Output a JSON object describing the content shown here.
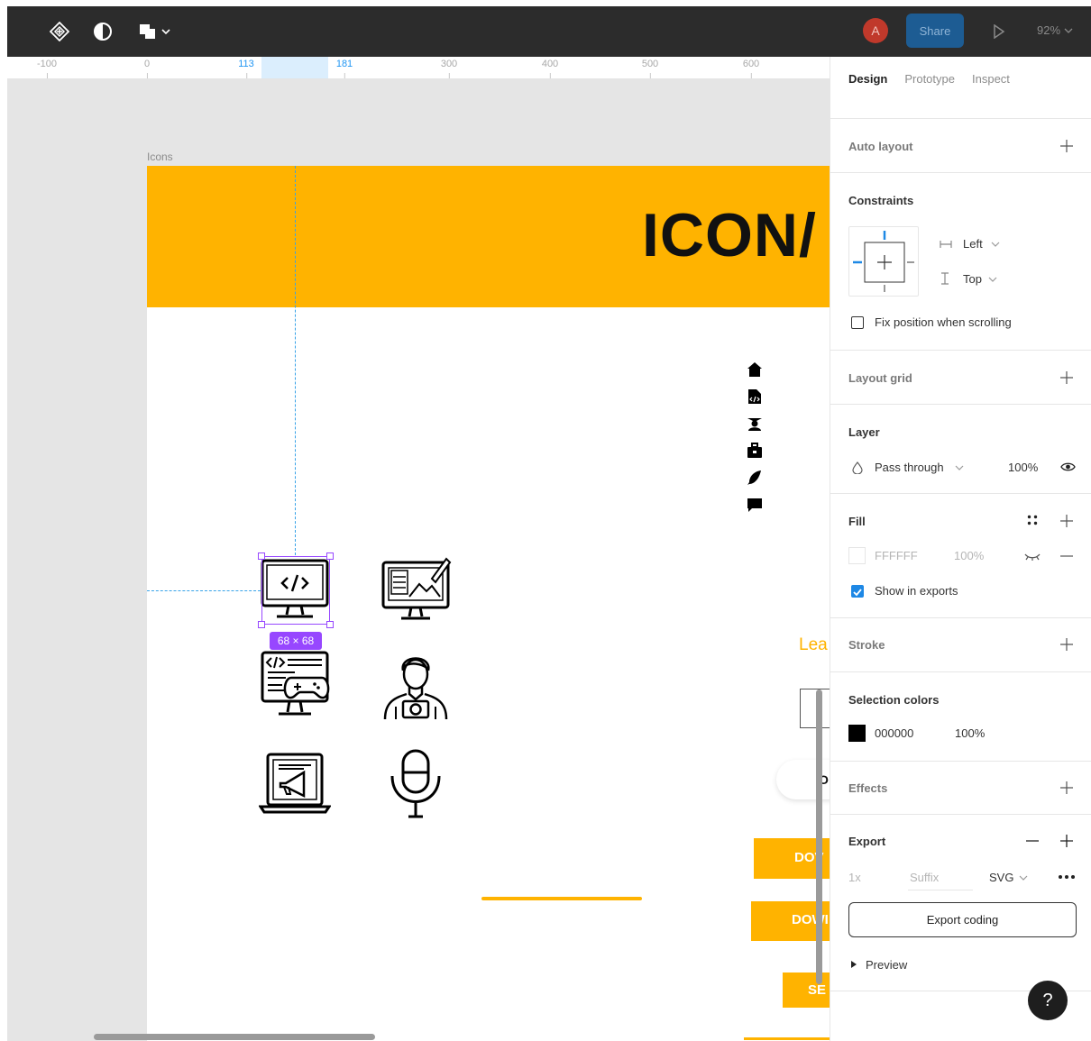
{
  "toolbar": {
    "icons": [
      "component-icon",
      "contrast-icon",
      "shapes-icon"
    ],
    "avatar_initial": "A",
    "share_label": "Share",
    "zoom": "92%"
  },
  "ruler": {
    "ticks": [
      {
        "label": "-100",
        "selected": false
      },
      {
        "label": "0",
        "selected": false
      },
      {
        "label": "113",
        "selected": true
      },
      {
        "label": "181",
        "selected": true
      },
      {
        "label": "300",
        "selected": false
      },
      {
        "label": "400",
        "selected": false
      },
      {
        "label": "500",
        "selected": false
      },
      {
        "label": "600",
        "selected": false
      }
    ]
  },
  "canvas": {
    "frame_label": "Icons",
    "banner_title": "ICON/",
    "selection_size": "68 × 68",
    "partial_text_lea": "Lea",
    "pill_text": "O",
    "buttons": [
      "DOV",
      "DOWI",
      "SE"
    ],
    "small_icons": [
      "home-icon",
      "code-file-icon",
      "graduate-icon",
      "briefcase-icon",
      "feather-icon",
      "comment-icon"
    ],
    "big_icons": [
      "monitor-code-icon",
      "monitor-design-icon",
      "monitor-game-code-icon",
      "photographer-icon",
      "laptop-megaphone-icon",
      "microphone-icon"
    ]
  },
  "panel": {
    "tabs": {
      "design": "Design",
      "prototype": "Prototype",
      "inspect": "Inspect"
    },
    "auto_layout": "Auto layout",
    "constraints": {
      "title": "Constraints",
      "horizontal": "Left",
      "vertical": "Top",
      "fix_position": "Fix position when scrolling"
    },
    "layout_grid": "Layout grid",
    "layer": {
      "title": "Layer",
      "blend": "Pass through",
      "opacity": "100%"
    },
    "fill": {
      "title": "Fill",
      "hex": "FFFFFF",
      "opacity": "100%",
      "show_in_exports": "Show in exports"
    },
    "stroke": "Stroke",
    "selection_colors": {
      "title": "Selection colors",
      "hex": "000000",
      "opacity": "100%"
    },
    "effects": "Effects",
    "export": {
      "title": "Export",
      "scale": "1x",
      "suffix_placeholder": "Suffix",
      "format": "SVG",
      "button": "Export coding",
      "preview": "Preview"
    },
    "help": "?"
  },
  "colors": {
    "toolbar_bg": "#2c2c2c",
    "brand_orange": "#ffb300",
    "selection_purple": "#9747ff",
    "accent_blue": "#1e88e5"
  }
}
